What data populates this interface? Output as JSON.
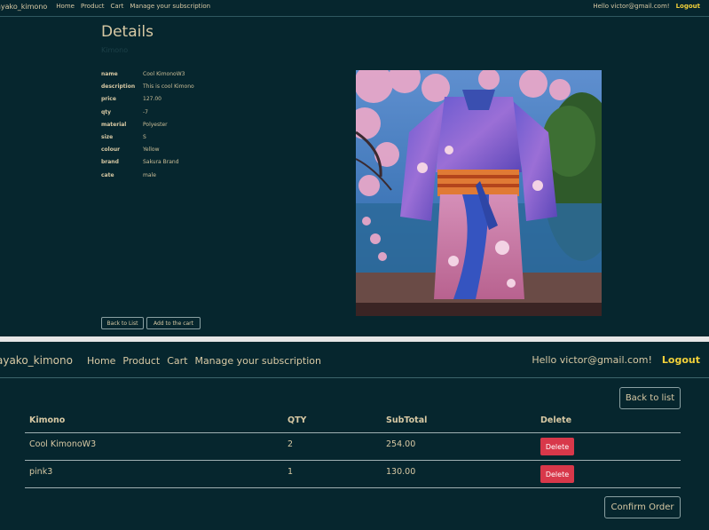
{
  "top": {
    "nav": {
      "brand": "ayako_kimono",
      "links": [
        "Home",
        "Product",
        "Cart",
        "Manage your subscription"
      ],
      "greeting": "Hello victor@gmail.com!",
      "logout": "Logout"
    },
    "title": "Details",
    "subtitle": "Kimono",
    "attributes": [
      {
        "key": "name",
        "value": "Cool KimonoW3"
      },
      {
        "key": "description",
        "value": "This is cool Kimono"
      },
      {
        "key": "price",
        "value": "127.00"
      },
      {
        "key": "qty",
        "value": "-7"
      },
      {
        "key": "material",
        "value": "Polyester"
      },
      {
        "key": "size",
        "value": "S"
      },
      {
        "key": "colour",
        "value": "Yellow"
      },
      {
        "key": "brand",
        "value": "Sakura Brand"
      },
      {
        "key": "cate",
        "value": "male"
      }
    ],
    "back_label": "Back to List",
    "add_label": "Add to the cart"
  },
  "bottom": {
    "nav": {
      "brand": "ayako_kimono",
      "links": [
        "Home",
        "Product",
        "Cart",
        "Manage your subscription"
      ],
      "greeting": "Hello victor@gmail.com!",
      "logout": "Logout"
    },
    "back_label": "Back to list",
    "headers": [
      "Kimono",
      "QTY",
      "SubTotal",
      "Delete"
    ],
    "rows": [
      {
        "kimono": "Cool KimonoW3",
        "qty": "2",
        "subtotal": "254.00",
        "delete": "Delete"
      },
      {
        "kimono": "pink3",
        "qty": "1",
        "subtotal": "130.00",
        "delete": "Delete"
      }
    ],
    "confirm_label": "Confirm Order"
  },
  "colors": {
    "background": "#06262e",
    "text": "#d8c9a4",
    "logout": "#f2d13a",
    "delete": "#d8384a"
  }
}
